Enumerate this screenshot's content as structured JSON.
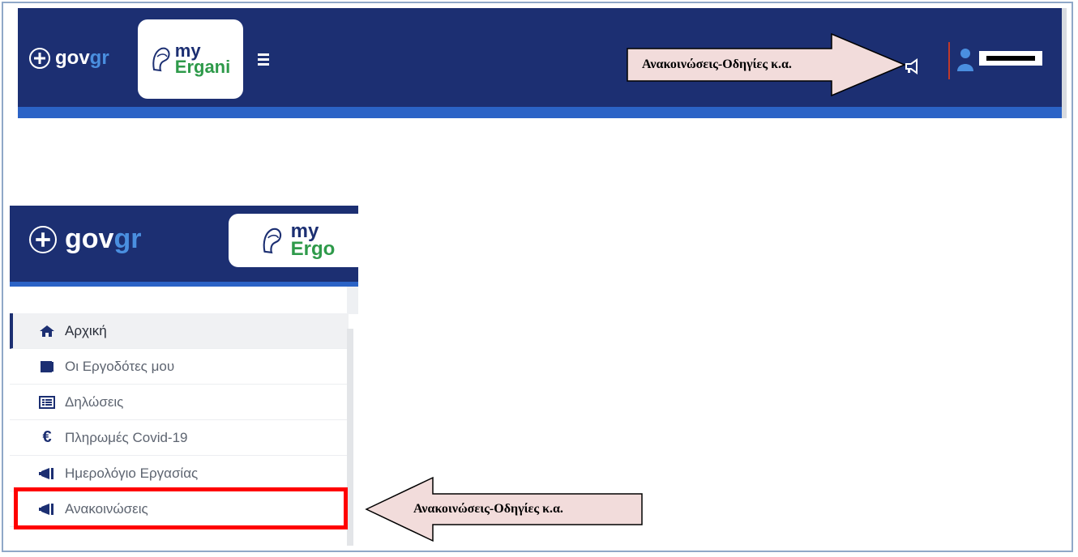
{
  "header": {
    "gov_prefix": "gov",
    "gov_suffix": "gr",
    "logo_my": "my",
    "logo_ergani": "Ergani"
  },
  "zoom_header": {
    "gov_prefix": "gov",
    "gov_suffix": "gr",
    "logo_my": "my",
    "logo_ergani": "Ergo"
  },
  "callouts": {
    "top_label": "Ανακοινώσεις-Οδηγίες κ.α.",
    "side_label": "Ανακοινώσεις-Οδηγίες κ.α."
  },
  "sidebar": {
    "items": [
      {
        "label": "Αρχική",
        "icon": "home-icon"
      },
      {
        "label": "Οι Εργοδότες μου",
        "icon": "book-icon"
      },
      {
        "label": "Δηλώσεις",
        "icon": "list-icon"
      },
      {
        "label": "Πληρωμές Covid-19",
        "icon": "euro-icon"
      },
      {
        "label": "Ημερολόγιο Εργασίας",
        "icon": "megaphone-icon"
      },
      {
        "label": "Ανακοινώσεις",
        "icon": "megaphone-icon"
      }
    ]
  },
  "colors": {
    "header_bg": "#1c2f72",
    "accent_blue": "#2b63c6",
    "callout_fill": "#f2dcdb",
    "highlight": "#ff0000"
  }
}
